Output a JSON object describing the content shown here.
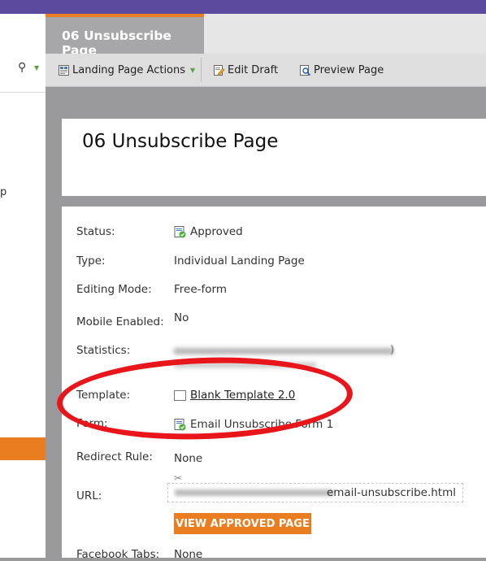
{
  "tab": {
    "title": "06 Unsubscribe Page"
  },
  "toolbar": {
    "actions_label": "Landing Page Actions",
    "edit_label": "Edit Draft",
    "preview_label": "Preview Page"
  },
  "left_panel": {
    "partial_text": "p"
  },
  "page": {
    "title": "06 Unsubscribe Page"
  },
  "details": {
    "status": {
      "label": "Status:",
      "value": "Approved"
    },
    "type": {
      "label": "Type:",
      "value": "Individual Landing Page"
    },
    "editing_mode": {
      "label": "Editing Mode:",
      "value": "Free-form"
    },
    "mobile": {
      "label": "Mobile Enabled:",
      "value": "No"
    },
    "statistics": {
      "label": "Statistics:",
      "value_visible": ")"
    },
    "template": {
      "label": "Template:",
      "value": "Blank Template 2.0"
    },
    "form": {
      "label": "Form:",
      "value": "Email Unsubscribe Form 1"
    },
    "redirect": {
      "label": "Redirect Rule:",
      "value": "None"
    },
    "url": {
      "label": "URL:",
      "value_visible": "email-unsubscribe.html"
    },
    "view_button": "VIEW APPROVED PAGE",
    "facebook": {
      "label": "Facebook Tabs:",
      "value": "None"
    }
  },
  "colors": {
    "accent": "#e97d1f",
    "brand_bar": "#5b4a9e",
    "annotation": "#e8151a"
  }
}
